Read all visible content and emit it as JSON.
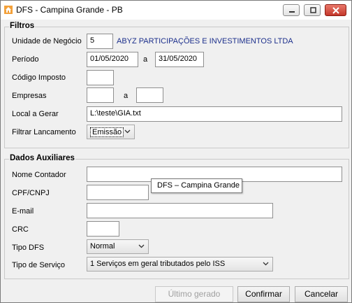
{
  "window": {
    "title": "DFS - Campina Grande - PB"
  },
  "filtros": {
    "title": "Filtros",
    "unidade_label": "Unidade de Negócio",
    "unidade_value": "5",
    "unidade_nome": "ABYZ PARTICIPAÇÕES E INVESTIMENTOS LTDA",
    "periodo_label": "Período",
    "periodo_inicio": "01/05/2020",
    "periodo_sep": "a",
    "periodo_fim": "31/05/2020",
    "codigo_label": "Código Imposto",
    "codigo_value": "",
    "empresas_label": "Empresas",
    "empresas_inicio": "",
    "empresas_sep": "a",
    "empresas_fim": "",
    "local_label": "Local a Gerar",
    "local_value": "L:\\teste\\GIA.txt",
    "filtrar_label": "Filtrar Lancamento",
    "filtrar_value": "Emissão"
  },
  "auxiliares": {
    "title": "Dados Auxiliares",
    "contador_label": "Nome Contador",
    "contador_value": "",
    "cpf_label": "CPF/CNPJ",
    "cpf_value": "",
    "email_label": "E-mail",
    "email_value": "",
    "crc_label": "CRC",
    "crc_value": "",
    "tipo_dfs_label": "Tipo DFS",
    "tipo_dfs_value": "Normal",
    "tipo_servico_label": "Tipo de Serviço",
    "tipo_servico_value": "1 Serviços em geral tributados pelo ISS"
  },
  "tooltip": {
    "text": "DFS – Campina Grande"
  },
  "buttons": {
    "ultimo": "Último gerado",
    "confirmar": "Confirmar",
    "cancelar": "Cancelar"
  },
  "colors": {
    "company_text": "#1c2f8c",
    "close_button": "#c4382b"
  }
}
